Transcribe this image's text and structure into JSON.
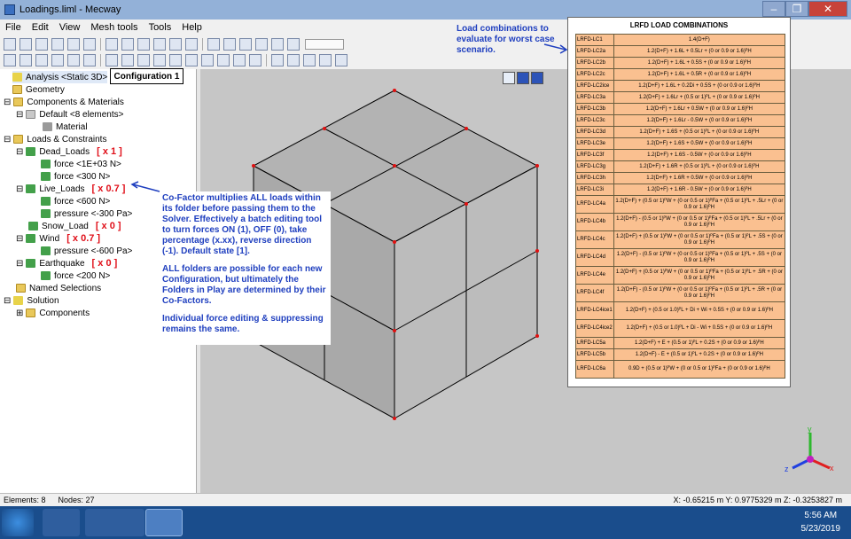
{
  "window": {
    "title": "Loadings.liml - Mecway",
    "min": "–",
    "max": "❐",
    "close": "✕"
  },
  "menu": [
    "File",
    "Edit",
    "View",
    "Mesh tools",
    "Tools",
    "Help"
  ],
  "tree": {
    "analysis": "Analysis <Static 3D>",
    "geometry": "Geometry",
    "components_materials": "Components & Materials",
    "default_comp": "Default <8 elements>",
    "material": "Material",
    "loads_constraints": "Loads & Constraints",
    "dead_loads": "Dead_Loads",
    "dead_factor": "[ x 1 ]",
    "dead_force1": "force <1E+03 N>",
    "dead_force2": "force <300 N>",
    "live_loads": "Live_Loads",
    "live_factor": "[ x 0.7 ]",
    "live_force": "force <600 N>",
    "live_pressure": "pressure <-300 Pa>",
    "snow_load": "Snow_Load",
    "snow_factor": "[ x 0 ]",
    "wind": "Wind",
    "wind_factor": "[ x 0.7 ]",
    "wind_pressure": "pressure <-600 Pa>",
    "earthquake": "Earthquake",
    "earthquake_factor": "[ x 0 ]",
    "earthquake_force": "force <200 N>",
    "named_selections": "Named Selections",
    "solution": "Solution",
    "components": "Components"
  },
  "config_label": "Configuration 1",
  "notes": {
    "cofactor": "Co-Factor multiplies ALL loads within its folder before passing them to the Solver.  Effectively a batch editing tool to turn forces ON (1), OFF (0), take percentage (x.xx), reverse direction (-1).   Default state [1].",
    "folders": "ALL folders are possible for each new Configuration, but ultimately the Folders in Play are determined by their Co-Factors.",
    "individual": "Individual force editing  & suppressing remains the same.",
    "loadcomb": "Load combinations to evaluate for worst case scenario."
  },
  "lrfd": {
    "title": "LRFD LOAD COMBINATIONS",
    "rows": [
      [
        "LRFD-LC1",
        "1.4(D+F)"
      ],
      [
        "LRFD-LC2a",
        "1.2(D+F) + 1.6L + 0.5Lr + (0 or 0.9 or 1.6)ᴾH"
      ],
      [
        "LRFD-LC2b",
        "1.2(D+F) + 1.6L + 0.5S + (0 or 0.9 or 1.6)ᴾH"
      ],
      [
        "LRFD-LC2c",
        "1.2(D+F) + 1.6L + 0.5R + (0 or 0.9 or 1.6)ᴾH"
      ],
      [
        "LRFD-LC2ice",
        "1.2(D+F) + 1.6L + 0.2Di + 0.5S + (0 or 0.9 or 1.6)ᴾH"
      ],
      [
        "LRFD-LC3a",
        "1.2(D+F) + 1.6Lr + (0.5 or 1)ᴾL + (0 or 0.9 or 1.6)ᴾH"
      ],
      [
        "LRFD-LC3b",
        "1.2(D+F) + 1.6Lr + 0.5W + (0 or 0.9 or 1.6)ᴾH"
      ],
      [
        "LRFD-LC3c",
        "1.2(D+F) + 1.6Lr - 0.5W + (0 or 0.9 or 1.6)ᴾH"
      ],
      [
        "LRFD-LC3d",
        "1.2(D+F) + 1.6S + (0.5 or 1)ᴾL + (0 or 0.9 or 1.6)ᴾH"
      ],
      [
        "LRFD-LC3e",
        "1.2(D+F) + 1.6S + 0.5W + (0 or 0.9 or 1.6)ᴾH"
      ],
      [
        "LRFD-LC3f",
        "1.2(D+F) + 1.6S - 0.5W + (0 or 0.9 or 1.6)ᴾH"
      ],
      [
        "LRFD-LC3g",
        "1.2(D+F) + 1.6R + (0.5 or 1)ᴾL + (0 or 0.9 or 1.6)ᴾH"
      ],
      [
        "LRFD-LC3h",
        "1.2(D+F) + 1.6R + 0.5W + (0 or 0.9 or 1.6)ᴾH"
      ],
      [
        "LRFD-LC3i",
        "1.2(D+F) + 1.6R - 0.5W + (0 or 0.9 or 1.6)ᴾH"
      ],
      [
        "LRFD-LC4a",
        "1.2(D+F) + (0.5 or 1)ᴾW + (0 or 0.5 or 1)ᴾFa + (0.5 or 1)ᴾL + .5Lr + (0 or 0.9 or 1.6)ᴾH"
      ],
      [
        "LRFD-LC4b",
        "1.2(D+F) - (0.5 or 1)ᴾW + (0 or 0.5 or 1)ᴾFa + (0.5 or 1)ᴾL + .5Lr + (0 or 0.9 or 1.6)ᴾH"
      ],
      [
        "LRFD-LC4c",
        "1.2(D+F) + (0.5 or 1)ᴾW + (0 or 0.5 or 1)ᴾFa + (0.5 or 1)ᴾL + .5S + (0 or 0.9 or 1.6)ᴾH"
      ],
      [
        "LRFD-LC4d",
        "1.2(D+F) - (0.5 or 1)ᴾW + (0 or 0.5 or 1)ᴾFa + (0.5 or 1)ᴾL + .5S + (0 or 0.9 or 1.6)ᴾH"
      ],
      [
        "LRFD-LC4e",
        "1.2(D+F) + (0.5 or 1)ᴾW + (0 or 0.5 or 1)ᴾFa + (0.5 or 1)ᴾL + .5R + (0 or 0.9 or 1.6)ᴾH"
      ],
      [
        "LRFD-LC4f",
        "1.2(D+F) - (0.5 or 1)ᴾW + (0 or 0.5 or 1)ᴾFa + (0.5 or 1)ᴾL + .5R + (0 or 0.9 or 1.6)ᴾH"
      ],
      [
        "LRFD-LC4ice1",
        "1.2(D+F) + (0.5 or 1.0)ᴾL + Di + Wi + 0.5S + (0 or 0.9 or 1.6)ᴾH"
      ],
      [
        "LRFD-LC4ice2",
        "1.2(D+F) + (0.5 or 1.0)ᴾL + Di - Wi + 0.5S + (0 or 0.9 or 1.6)ᴾH"
      ],
      [
        "LRFD-LC5a",
        "1.2(D+F) + E + (0.5 or 1)ᴾL + 0.2S + (0 or 0.9 or 1.6)ᴾH"
      ],
      [
        "LRFD-LC5b",
        "1.2(D+F) - E + (0.5 or 1)ᴾL + 0.2S + (0 or 0.9 or 1.6)ᴾH"
      ],
      [
        "LRFD-LC6a",
        "0.9D + (0.5 or 1)ᴾW + (0 or 0.5 or 1)ᴾFa + (0 or 0.9 or 1.6)ᴾH"
      ]
    ]
  },
  "status": {
    "elements": "Elements: 8",
    "nodes": "Nodes: 27",
    "coords": "X: -0.65215 m Y: 0.9775329 m Z: -0.3253827 m"
  },
  "clock": {
    "time": "5:56 AM",
    "date": "5/23/2019"
  },
  "axes": {
    "x": "x",
    "y": "y",
    "z": "z"
  }
}
